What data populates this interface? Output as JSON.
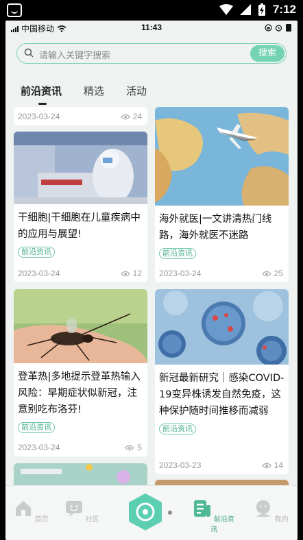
{
  "android_status": {
    "time": "7:12"
  },
  "ios_status": {
    "carrier": "中国移动",
    "time": "11:43"
  },
  "search": {
    "placeholder": "请输入关键字搜索",
    "button": "搜索"
  },
  "tabs": [
    {
      "label": "前沿资讯",
      "active": true
    },
    {
      "label": "精选",
      "active": false
    },
    {
      "label": "活动",
      "active": false
    }
  ],
  "partial_top_card": {
    "date": "2023-03-24",
    "views": "24"
  },
  "cards": [
    {
      "title": "干细胞|干细胞在儿童疾病中的应用与展望!",
      "tag": "前沿资讯",
      "date": "2023-03-24",
      "views": "12",
      "image": "lab-scientist"
    },
    {
      "title": "海外就医|一文讲清热门线路，海外就医不迷路",
      "tag": "前沿资讯",
      "date": "2023-03-24",
      "views": "25",
      "image": "airplane-map"
    },
    {
      "title": "登革热|多地提示登革热输入风险：早期症状似新冠，注意别吃布洛芬!",
      "tag": "前沿资讯",
      "date": "2023-03-24",
      "views": "5",
      "image": "mosquito"
    },
    {
      "title": "新冠最新研究｜感染COVID-19变异株诱发自然免疫，这种保护随时间推移而减弱",
      "tag": "前沿资讯",
      "date": "2023-03-23",
      "views": "14",
      "image": "virus"
    }
  ],
  "bottom_nav": [
    {
      "label": "首页",
      "icon": "home-icon",
      "active": false
    },
    {
      "label": "社区",
      "icon": "community-icon",
      "active": false
    },
    {
      "label": "前沿资讯",
      "icon": "news-icon",
      "active": true
    },
    {
      "label": "我的",
      "icon": "profile-icon",
      "active": false
    }
  ],
  "colors": {
    "accent": "#74d3b5",
    "tag": "#46ad8b",
    "background": "#eef2f1"
  }
}
